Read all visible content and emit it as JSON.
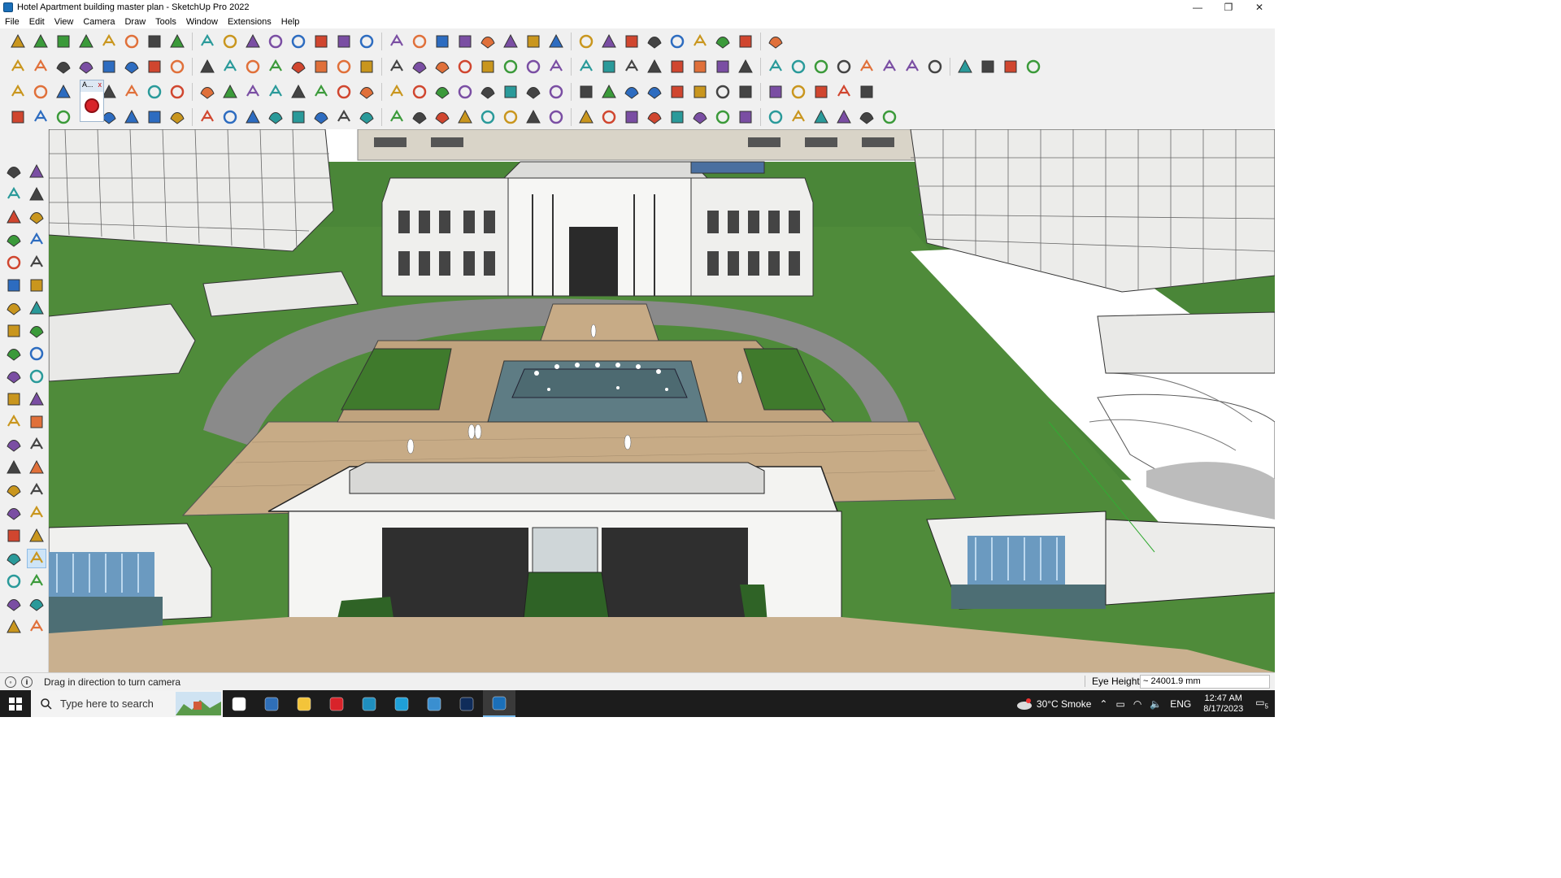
{
  "window": {
    "title": "Hotel Apartment building master plan - SketchUp Pro 2022",
    "controls": {
      "minimize": "—",
      "restore": "❐",
      "close": "✕"
    }
  },
  "menu": [
    "File",
    "Edit",
    "View",
    "Camera",
    "Draw",
    "Tools",
    "Window",
    "Extensions",
    "Help"
  ],
  "toolbars": {
    "row1": [
      "zoom-icon",
      "select-icon",
      "eraser-icon",
      "line-icon",
      "freehand-icon",
      "rectangle-icon",
      "push-pull-icon",
      "follow-me-icon",
      "move-icon",
      "rotate-icon",
      "scale-icon",
      "tape-icon",
      "text-icon",
      "paint-icon",
      "orbit-icon",
      "pan-icon",
      "zoom-window-icon",
      "zoom-extents-icon",
      "section-icon",
      "layers-icon",
      "sandbox-icon",
      "styles-icon",
      "user-icon",
      "component-icon",
      "warehouse-icon",
      "ruby-icon",
      "sort-icon",
      "sort-desc-icon",
      "axes-icon",
      "solid-icon",
      "undo-icon",
      "redo-icon",
      "hand-icon"
    ],
    "row2": [
      "box-icon",
      "box2-icon",
      "box3-icon",
      "push-icon",
      "extrude-icon",
      "extrude2-icon",
      "extrude3-icon",
      "extrude4-icon",
      "extrude5-icon",
      "extrude6-icon",
      "curve-icon",
      "panel-icon",
      "panel2-icon",
      "panel3-icon",
      "layer-green-icon",
      "plant-icon",
      "house-icon",
      "house2-icon",
      "home-icon",
      "shop-icon",
      "home2-icon",
      "shed-icon",
      "fx-icon",
      "hand-point-icon",
      "pencil-red-icon",
      "shape-octagon-icon",
      "circle-icon",
      "pentagon-icon",
      "ellipse-icon",
      "parallelogram-icon",
      "arc-icon",
      "arc2-icon",
      "arc3-icon",
      "spiral-icon",
      "loop-icon",
      "line-red-icon",
      "eraser-pink-icon",
      "books-icon",
      "book-grid-icon",
      "drape-icon",
      "fold-icon",
      "bag-icon",
      "tile-icon",
      "tile2-icon"
    ],
    "row3": [
      "plane-blue-icon",
      "plane-blue2-icon",
      "plane-yellow-icon",
      "tag-icon",
      "stack-icon",
      "loop-orange-icon",
      "square-red-icon",
      "grid-icon",
      "page-icon",
      "box-brown-icon",
      "link-icon",
      "bend-icon",
      "curve-dots-icon",
      "cross-red-icon",
      "cross-green-icon",
      "cross-blue-icon",
      "cone-icon",
      "tree-icon",
      "warning-icon",
      "rope-icon",
      "rope2-icon",
      "rope3-icon",
      "cross-cyan-icon",
      "bucket-icon",
      "undo-red-icon",
      "grid-green-icon",
      "shape-red-icon",
      "shape-red2-icon",
      "tag-red-icon",
      "stamp-icon",
      "window-icon",
      "hatch-icon",
      "hatch2-icon",
      "hatch3-icon",
      "dots-red-icon",
      "dotcurve-icon",
      "grid-small-icon"
    ],
    "row4": [
      "flow-icon",
      "path-icon",
      "car-icon",
      "cube-outline-icon",
      "cloud-icon",
      "spring-icon",
      "sphere-icon",
      "dome-icon",
      "helix-icon",
      "corner-icon",
      "corner2-icon",
      "stair-icon",
      "spline-icon",
      "frame-icon",
      "cone-outline-icon",
      "fence-icon",
      "cage-icon",
      "shell-icon",
      "leaf-icon",
      "chevron-icon",
      "stair2-icon",
      "slope-icon",
      "zigzag-icon",
      "zigzag2-icon",
      "zigzag3-icon",
      "arch-icon",
      "ramp-icon",
      "door-icon",
      "bridge-icon",
      "shelf-icon",
      "roof-icon",
      "grid-fill-icon",
      "fence2-icon",
      "hex-icon",
      "rake-icon",
      "cluster-icon",
      "cone-dark-icon",
      "diamond-icon"
    ]
  },
  "floating_tag": {
    "label": "A...",
    "close": "x"
  },
  "left_tools": [
    [
      "select-arrow-icon",
      "orbit-hand-icon"
    ],
    [
      "paint-bucket-icon",
      "eraser-left-icon"
    ],
    [
      "components-icon",
      "tape-measure-icon"
    ],
    [
      "pencil-line-icon",
      "freehand-curve-icon"
    ],
    [
      "rectangle-tool-icon",
      "rotated-rect-icon"
    ],
    [
      "circle-tool-icon",
      "polygon-tool-icon"
    ],
    [
      "arc-tool-icon",
      "pie-tool-icon"
    ],
    [
      "arc-2pt-icon",
      "arc-3pt-icon"
    ],
    [
      "move-tool-icon",
      "push-pull-tool-icon"
    ],
    [
      "rotate-tool-icon",
      "follow-me-tool-icon"
    ],
    [
      "scale-tool-icon",
      "offset-tool-icon"
    ],
    [
      "tape-tool-icon",
      "dimension-tool-icon"
    ],
    [
      "protractor-icon",
      "text-tool-icon"
    ],
    [
      "axes-tool-icon",
      "3dtext-tool-icon"
    ],
    [
      "orbit-tool-icon",
      "pan-tool-icon"
    ],
    [
      "zoom-tool-icon",
      "zoom-window-tool-icon"
    ],
    [
      "zoom-extents-tool-icon",
      "previous-view-icon"
    ],
    [
      "position-camera-icon",
      "look-around-icon"
    ],
    [
      "walk-icon",
      "section-plane-icon"
    ],
    [
      "display-section-icon",
      "section-cuts-icon"
    ],
    [
      "section-fill-icon",
      "section-fill2-icon"
    ]
  ],
  "status": {
    "hint": "Drag in direction to turn camera",
    "measure_label": "Eye Height",
    "measure_value": "~ 24001.9 mm"
  },
  "taskbar": {
    "search_placeholder": "Type here to search",
    "apps": [
      "task-view-icon",
      "calculator-icon",
      "file-explorer-icon",
      "acrobat-icon",
      "maps-icon",
      "edge-icon",
      "snipping-icon",
      "photoshop-icon",
      "sketchup-icon"
    ],
    "weather": "30°C  Smoke",
    "language": "ENG",
    "time": "12:47 AM",
    "date": "8/17/2023",
    "notifications": "5"
  },
  "colors": {
    "grass": "#4e8a3a",
    "paving": "#c9b08f",
    "water": "#5f7f86",
    "building": "#f2f2f0",
    "path": "#8c8c8c"
  }
}
